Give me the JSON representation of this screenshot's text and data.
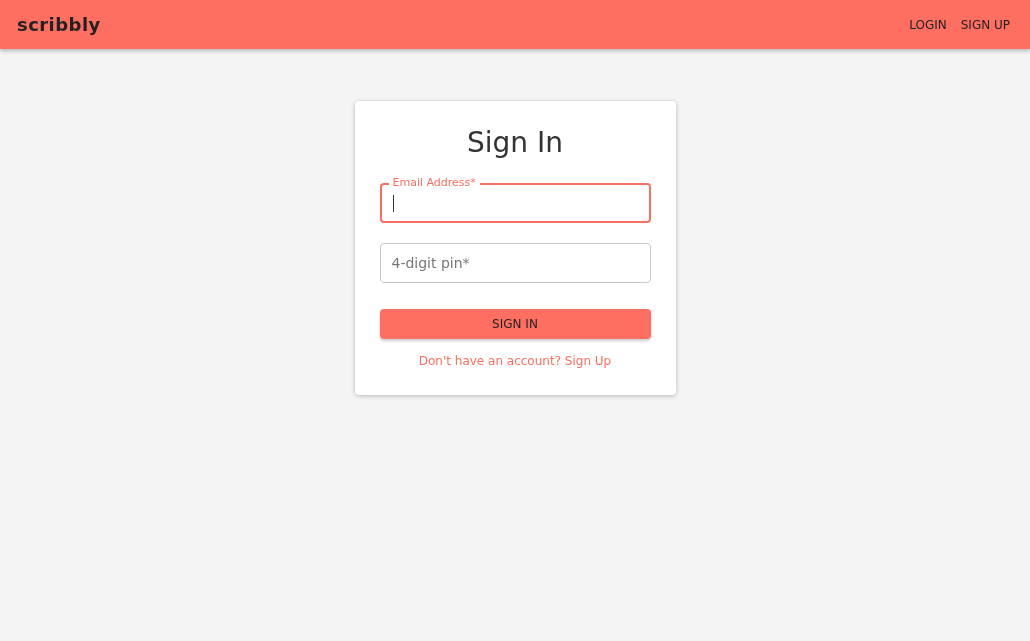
{
  "app_bar": {
    "logo": "scribbly",
    "links": [
      {
        "label": "LOGIN"
      },
      {
        "label": "SIGN UP"
      }
    ]
  },
  "card": {
    "title": "Sign In",
    "fields": [
      {
        "label": "Email Address",
        "required_mark": "*",
        "focused": true
      },
      {
        "label": "4-digit pin",
        "required_mark": "*",
        "focused": false
      }
    ],
    "button": "SIGN IN",
    "link": "Don't have an account? Sign Up"
  }
}
